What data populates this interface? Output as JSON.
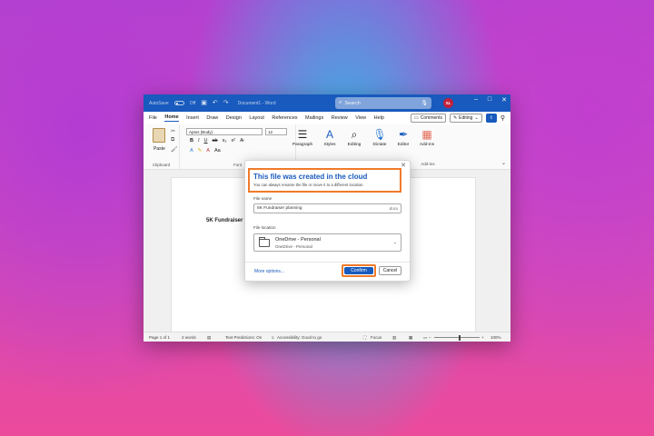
{
  "titlebar": {
    "autosave": "AutoSave",
    "autosave_state": "Off",
    "doc_title": "Document1 - Word",
    "search_placeholder": "Search",
    "user_initials": "SL"
  },
  "menu": {
    "tabs": [
      "File",
      "Home",
      "Insert",
      "Draw",
      "Design",
      "Layout",
      "References",
      "Mailings",
      "Review",
      "View",
      "Help"
    ],
    "active_tab": "Home",
    "comments": "Comments",
    "editing": "Editing"
  },
  "ribbon": {
    "paste": "Paste",
    "clipboard": "Clipboard",
    "font_name": "Aptos (Body)",
    "font_size": "12",
    "font": "Font",
    "paragraph": "Paragraph",
    "styles": "Styles",
    "editing": "Editing",
    "dictate": "Dictate",
    "editor": "Editor",
    "addins": "Add-ins",
    "voice": "Voice",
    "addins_group": "Add-ins"
  },
  "document": {
    "text": "5K Fundraiser"
  },
  "status": {
    "page": "Page 1 of 1",
    "words": "2 words",
    "predictions": "Text Predictions: On",
    "accessibility": "Accessibility: Good to go",
    "focus": "Focus",
    "zoom": "100%"
  },
  "dialog": {
    "title": "This file was created in the cloud",
    "subtitle": "You can always rename the file or move it to a different location.",
    "file_name_label": "File name",
    "file_name_value": "5K Fundraiser planning",
    "file_ext": ".docx",
    "location_label": "File location",
    "location_name": "OneDrive - Personal",
    "location_sub": "OneDrive - Personal",
    "more_options": "More options...",
    "confirm": "Confirm",
    "cancel": "Cancel"
  },
  "colors": {
    "accent": "#185abd",
    "highlight": "#f07a2a"
  }
}
